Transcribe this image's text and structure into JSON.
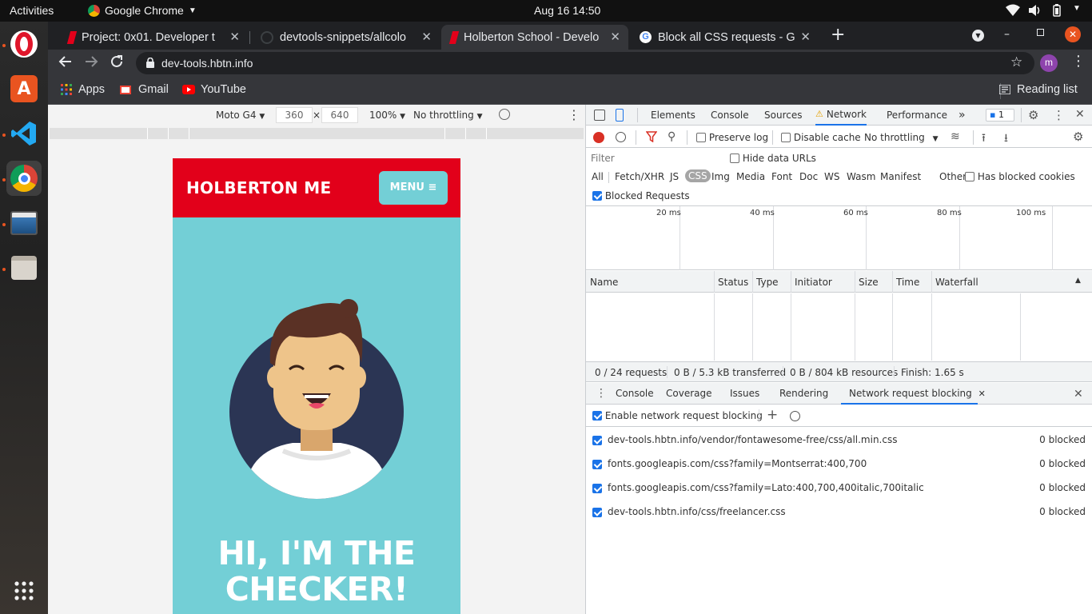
{
  "desktop": {
    "activities": "Activities",
    "app_name": "Google Chrome",
    "clock": "Aug 16  14:50"
  },
  "tabs": [
    {
      "title": "Project: 0x01. Developer t",
      "active": false
    },
    {
      "title": "devtools-snippets/allcolo",
      "active": false
    },
    {
      "title": "Holberton School - Develo",
      "active": true
    },
    {
      "title": "Block all CSS requests - Go",
      "active": false
    }
  ],
  "omnibox": {
    "url": "dev-tools.hbtn.info",
    "avatar": "m"
  },
  "bookmarks": {
    "apps": "Apps",
    "gmail": "Gmail",
    "youtube": "YouTube",
    "reading_list": "Reading list"
  },
  "device_toolbar": {
    "device": "Moto G4",
    "width": "360",
    "times": "×",
    "height": "640",
    "zoom": "100%",
    "throttling": "No throttling"
  },
  "page": {
    "brand": "HOLBERTON ME",
    "menu": "MENU",
    "hero_line1": "HI, I'M THE",
    "hero_line2": "CHECKER!"
  },
  "devtools": {
    "tabs": [
      "Elements",
      "Console",
      "Sources",
      "Network",
      "Performance"
    ],
    "active_tab": "Network",
    "issues_count": "1",
    "network": {
      "preserve_log": "Preserve log",
      "disable_cache": "Disable cache",
      "throttling": "No throttling",
      "filter_placeholder": "Filter",
      "hide_data_urls": "Hide data URLs",
      "types": [
        "All",
        "Fetch/XHR",
        "JS",
        "CSS",
        "Img",
        "Media",
        "Font",
        "Doc",
        "WS",
        "Wasm",
        "Manifest",
        "Other"
      ],
      "active_type": "CSS",
      "has_blocked_cookies": "Has blocked cookies",
      "blocked_requests": "Blocked Requests",
      "timeline_ticks": [
        "20 ms",
        "40 ms",
        "60 ms",
        "80 ms",
        "100 ms"
      ],
      "columns": [
        "Name",
        "Status",
        "Type",
        "Initiator",
        "Size",
        "Time",
        "Waterfall"
      ],
      "summary": {
        "requests": "0 / 24 requests",
        "transferred": "0 B / 5.3 kB transferred",
        "resources": "0 B / 804 kB resources",
        "finish": "Finish: 1.65 s"
      }
    },
    "drawer": {
      "tabs": [
        "Console",
        "Coverage",
        "Issues",
        "Rendering",
        "Network request blocking"
      ],
      "active_tab": "Network request blocking",
      "enable_label": "Enable network request blocking",
      "patterns": [
        {
          "url": "dev-tools.hbtn.info/vendor/fontawesome-free/css/all.min.css",
          "status": "0 blocked"
        },
        {
          "url": "fonts.googleapis.com/css?family=Montserrat:400,700",
          "status": "0 blocked"
        },
        {
          "url": "fonts.googleapis.com/css?family=Lato:400,700,400italic,700italic",
          "status": "0 blocked"
        },
        {
          "url": "dev-tools.hbtn.info/css/freelancer.css",
          "status": "0 blocked"
        }
      ]
    }
  },
  "colors": {
    "brand_red": "#e2001a",
    "hero_teal": "#73cfd6",
    "menu_teal": "#73cfd6",
    "ubuntu_orange": "#e95420",
    "devtools_blue": "#1a73e8"
  }
}
